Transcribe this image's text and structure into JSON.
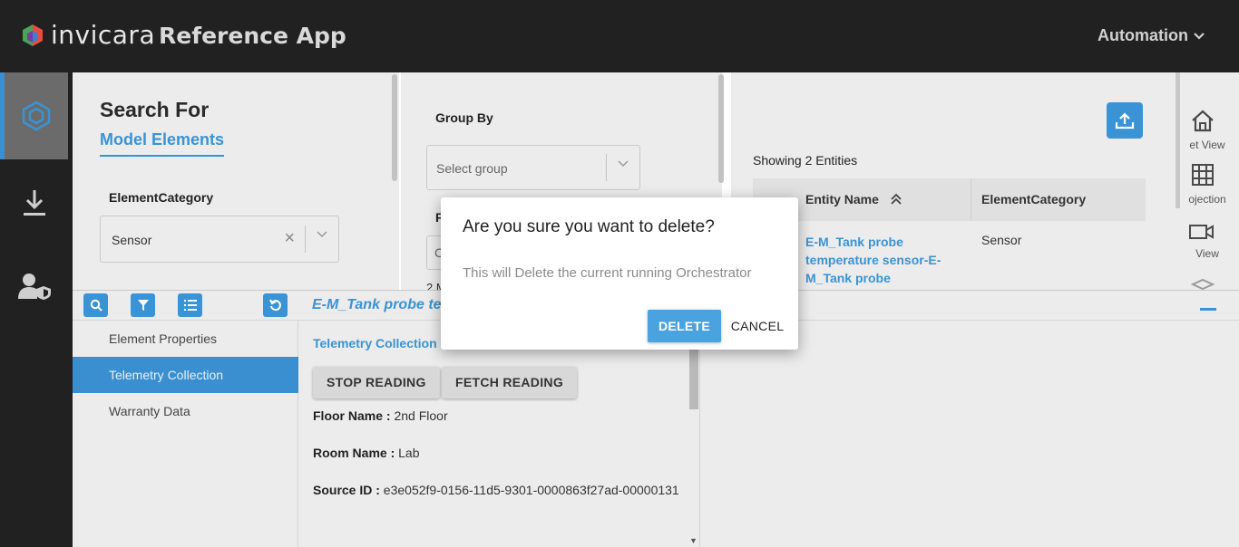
{
  "header": {
    "brand": "invicara",
    "app_title": "Reference App",
    "user_menu": "Automation"
  },
  "left_nav": [
    {
      "icon": "cube-icon",
      "active": true
    },
    {
      "icon": "download-icon",
      "active": false
    },
    {
      "icon": "user-shield-icon",
      "active": false
    }
  ],
  "search": {
    "title": "Search For",
    "subtitle": "Model Elements",
    "field_label": "ElementCategory",
    "field_value": "Sensor"
  },
  "group": {
    "label": "Group By",
    "placeholder": "Select group",
    "second_label": "F",
    "second_placeholder": "C",
    "count_text": "2 M"
  },
  "results": {
    "showing": "Showing 2 Entities",
    "columns": [
      "Entity Name",
      "ElementCategory"
    ],
    "rows": [
      {
        "name": "E-M_Tank probe temperature sensor-E-M_Tank probe temperature",
        "category": "Sensor"
      }
    ]
  },
  "right_tools": [
    {
      "icon": "home-icon",
      "label": "et View"
    },
    {
      "icon": "grid-icon",
      "label": "ojection"
    },
    {
      "icon": "video-camera-icon",
      "label": "View"
    }
  ],
  "detail": {
    "title": "E-M_Tank probe te",
    "menu": [
      "Element Properties",
      "Telemetry Collection",
      "Warranty Data"
    ],
    "active_menu_index": 1,
    "section_title": "Telemetry Collection",
    "stop_button": "STOP READING",
    "fetch_button": "FETCH READING",
    "floor_key": "Floor Name :",
    "floor_value": "2nd Floor",
    "room_key": "Room Name :",
    "room_value": "Lab",
    "source_key": "Source ID :",
    "source_value": "e3e052f9-0156-11d5-9301-0000863f27ad-00000131",
    "cutoff_text": "T ........ d ..., Th..."
  },
  "dialog": {
    "title": "Are you sure you want to delete?",
    "body": "This will Delete the current running Orchestrator",
    "confirm": "DELETE",
    "cancel": "CANCEL"
  },
  "colors": {
    "accent": "#3a93d4",
    "topbar": "#212121",
    "panel": "#ececec"
  }
}
